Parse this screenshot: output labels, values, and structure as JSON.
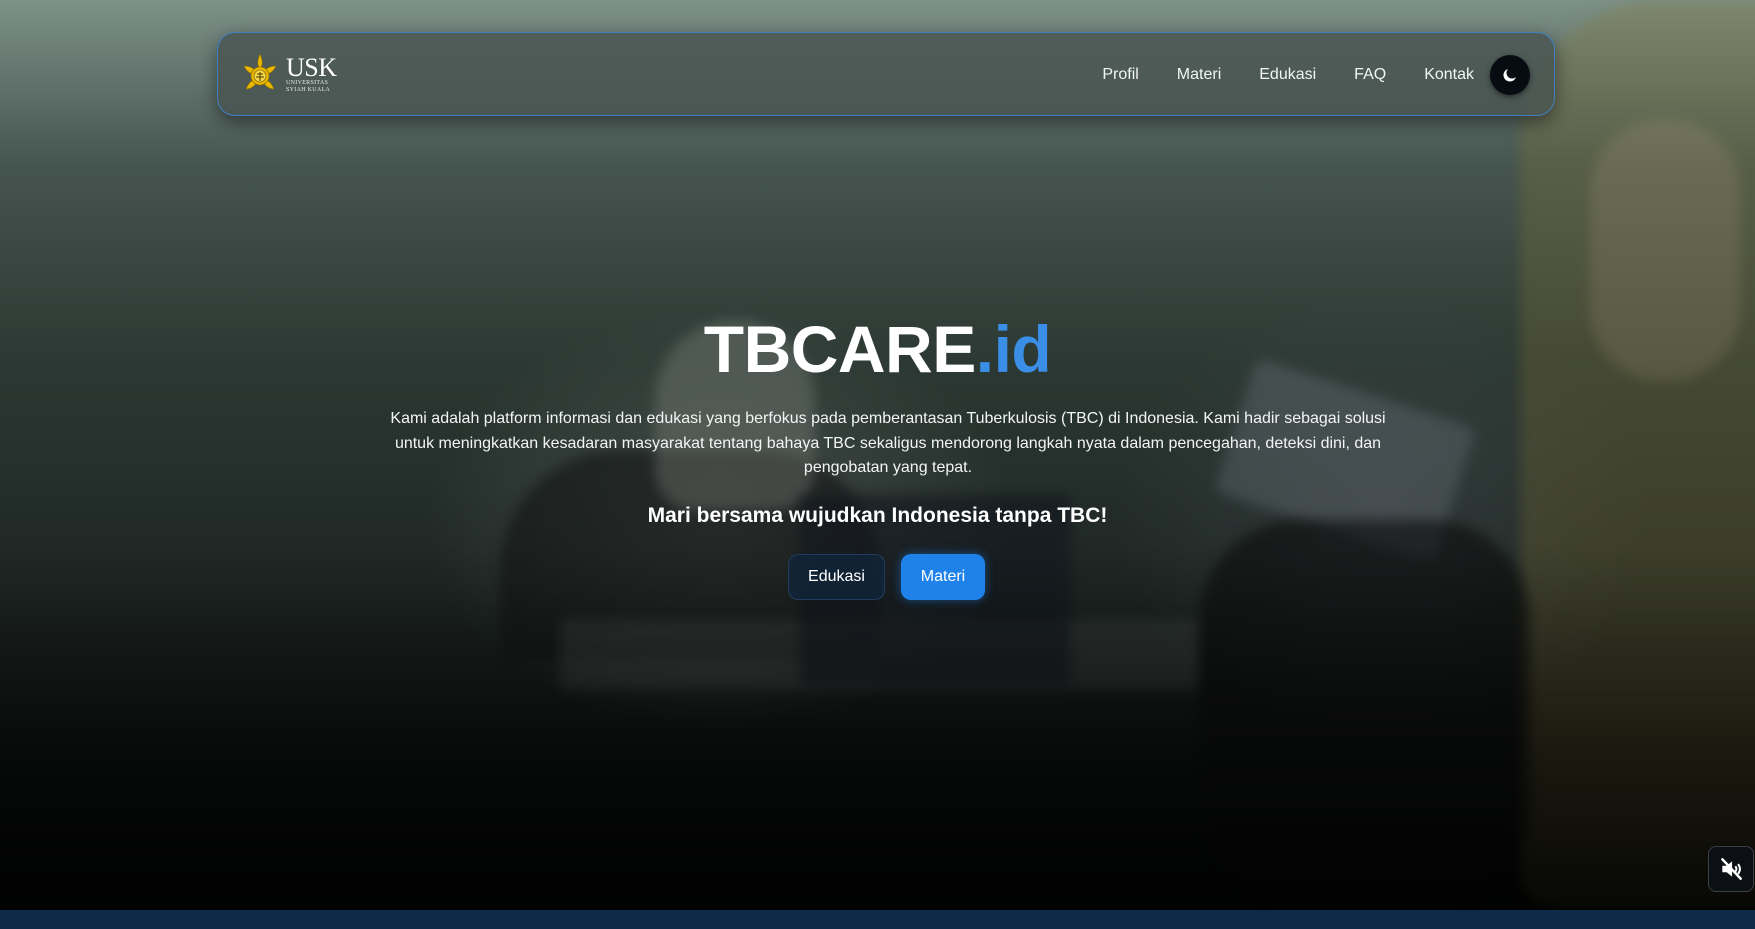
{
  "navbar": {
    "logo": {
      "title": "USK",
      "subtitle_line1": "UNIVERSITAS",
      "subtitle_line2": "SYIAH KUALA"
    },
    "links": [
      "Profil",
      "Materi",
      "Edukasi",
      "FAQ",
      "Kontak"
    ],
    "theme_toggle_icon": "moon-icon"
  },
  "hero": {
    "title_main": "TBCARE",
    "title_accent": ".id",
    "description": "Kami adalah platform informasi dan edukasi yang berfokus pada pemberantasan Tuberkulosis (TBC) di Indonesia. Kami hadir sebagai solusi untuk meningkatkan kesadaran masyarakat tentang bahaya TBC sekaligus mendorong langkah nyata dalam pencegahan, deteksi dini, dan pengobatan yang tepat.",
    "tagline": "Mari bersama wujudkan Indonesia tanpa TBC!",
    "buttons": {
      "edukasi": "Edukasi",
      "materi": "Materi"
    }
  },
  "video": {
    "mute_icon": "volume-muted-icon"
  },
  "colors": {
    "accent": "#3b8ee6",
    "primary_button": "#1e82ea",
    "nav_border": "#3f7fc0"
  }
}
